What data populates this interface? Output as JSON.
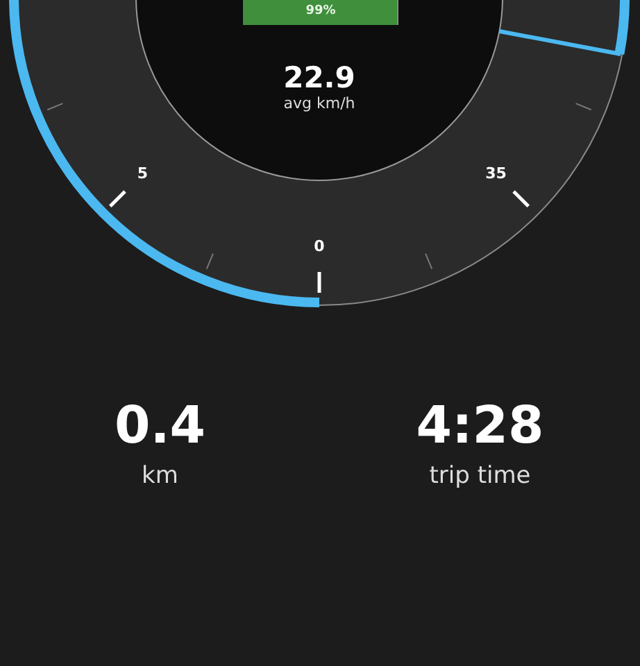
{
  "battery": {
    "label": "99%",
    "level": 0.99
  },
  "average_speed": {
    "value": "22.9",
    "unit": "avg km/h"
  },
  "gauge": {
    "scale_labels": [
      "5",
      "35",
      "0"
    ]
  },
  "stats": [
    {
      "value": "0.4",
      "label": "km"
    },
    {
      "value": "4:28",
      "label": "trip time"
    }
  ]
}
